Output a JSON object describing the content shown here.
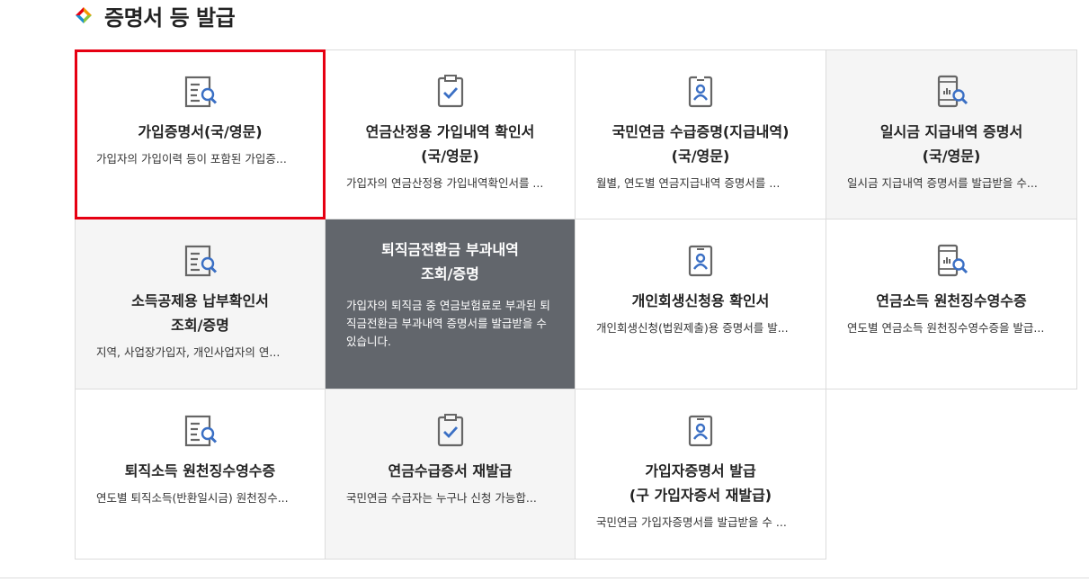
{
  "section": {
    "title": "증명서 등 발급",
    "bullet_colors": [
      "#f39800",
      "#8cc63f",
      "#e60012",
      "#1d8fd1"
    ]
  },
  "cards": [
    {
      "title": "가입증명서(국/영문)",
      "desc": "가입자의 가입이력 등이 포함된 가입증...",
      "icon": "document-search-icon",
      "selected": true
    },
    {
      "title": "연금산정용 가입내역 확인서\n(국/영문)",
      "desc": "가입자의 연금산정용 가입내역확인서를 ...",
      "icon": "clipboard-check-icon"
    },
    {
      "title": "국민연금 수급증명(지급내역)\n(국/영문)",
      "desc": "월별, 연도별 연금지급내역 증명서를 ...",
      "icon": "id-badge-icon"
    },
    {
      "title": "일시금 지급내역 증명서\n(국/영문)",
      "desc": "일시금 지급내역 증명서를 발급받을 수...",
      "icon": "mobile-chart-search-icon"
    },
    {
      "title": "소득공제용 납부확인서\n조회/증명",
      "desc": "지역, 사업장가입자, 개인사업자의 연...",
      "icon": "document-search-icon"
    },
    {
      "title": "퇴직금전환금 부과내역\n조회/증명",
      "desc": "가입자의 퇴직금 중 연금보험료로 부과된 퇴직금전환금 부과내역 증명서를 발급받을 수 있습니다.",
      "icon": "",
      "hover": true
    },
    {
      "title": "개인회생신청용 확인서",
      "desc": "개인회생신청(법원제출)용 증명서를 발...",
      "icon": "id-badge-icon"
    },
    {
      "title": "연금소득 원천징수영수증",
      "desc": "연도별 연금소득 원천징수영수증을 발급...",
      "icon": "mobile-chart-search-icon"
    },
    {
      "title": "퇴직소득 원천징수영수증",
      "desc": "연도별 퇴직소득(반환일시금) 원천징수...",
      "icon": "document-search-icon"
    },
    {
      "title": "연금수급증서 재발급",
      "desc": "국민연금 수급자는 누구나 신청 가능합...",
      "icon": "clipboard-check-icon"
    },
    {
      "title": "가입자증명서 발급\n(구 가입자증서 재발급)",
      "desc": "국민연금 가입자증명서를 발급받을 수 ...",
      "icon": "id-badge-icon"
    }
  ],
  "colors": {
    "selected_border": "#e60012",
    "hover_bg": "#62666c",
    "gray_bg": "#f5f5f5",
    "icon_gray": "#666666",
    "icon_blue": "#3a6fc4"
  }
}
